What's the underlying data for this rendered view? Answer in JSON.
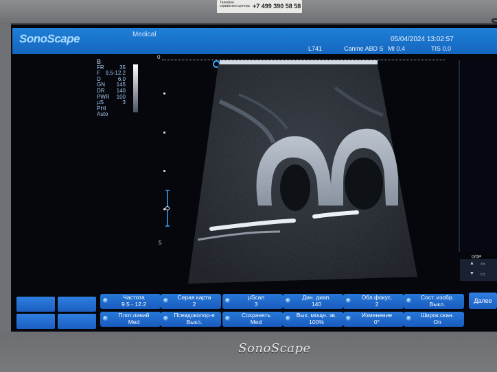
{
  "sticker": {
    "line1": "Телефон сервисного центра",
    "phone": "+7 499 390 58 58"
  },
  "brand_corner": "S",
  "header": {
    "logo": "SonoScape",
    "mode": "Medical",
    "datetime": "05/04/2024 13:02:57",
    "probe": "L741",
    "preset": "Canine ABD S",
    "mi": "MI 0.4",
    "tis": "TIS 0.0"
  },
  "params": {
    "mode": "B",
    "rows": [
      {
        "k": "FR",
        "v": "35"
      },
      {
        "k": "F",
        "v": "9.5-12.2"
      },
      {
        "k": "D",
        "v": "6.0"
      },
      {
        "k": "GN",
        "v": "145"
      },
      {
        "k": "DR",
        "v": "140"
      },
      {
        "k": "PWR",
        "v": "100"
      },
      {
        "k": "μS",
        "v": "3"
      },
      {
        "k": "PHI",
        "v": ""
      },
      {
        "k": "Auto",
        "v": ""
      }
    ]
  },
  "depth": {
    "zero": "0",
    "five": "5"
  },
  "right_panel": {
    "label": "0/0P"
  },
  "softkeys": [
    {
      "title": "Частота",
      "value": "9.5 - 12.2"
    },
    {
      "title": "Серая карта",
      "value": "2"
    },
    {
      "title": "μScan",
      "value": "3"
    },
    {
      "title": "Дин. диап.",
      "value": "140"
    },
    {
      "title": "Обл.фокус.",
      "value": "2"
    },
    {
      "title": "Сост. изобр.",
      "value": "Выкл."
    },
    {
      "title": "Плот.линий",
      "value": "Med"
    },
    {
      "title": "Псевдоколор-я",
      "value": "Выкл."
    },
    {
      "title": "Сохранять",
      "value": "Med"
    },
    {
      "title": "Вых. мощн. зв.",
      "value": "100%"
    },
    {
      "title": "Изменение",
      "value": "0°"
    },
    {
      "title": "Широк.скан.",
      "value": "On"
    }
  ],
  "next_label": "Далее",
  "bottom_logo": "SonoScape"
}
